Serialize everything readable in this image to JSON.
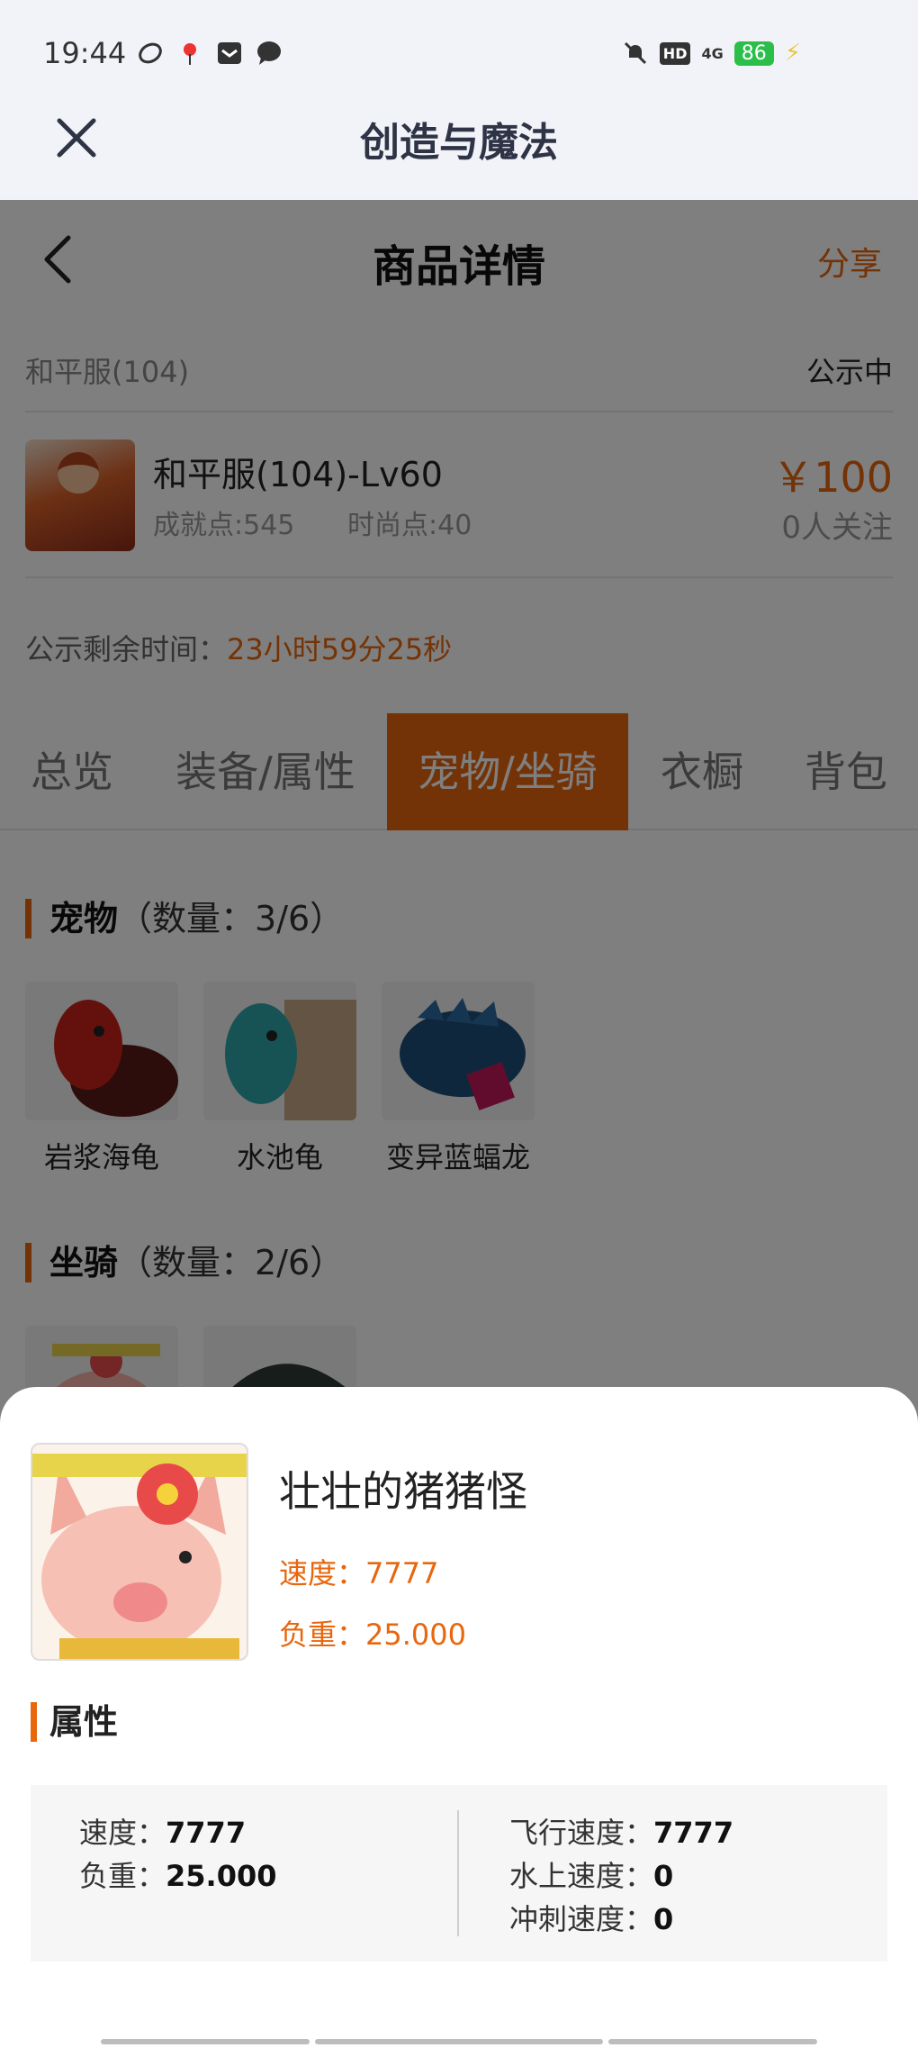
{
  "status_bar": {
    "time": "19:44",
    "network": "4G",
    "battery": "86"
  },
  "app_bar": {
    "title": "创造与魔法"
  },
  "nav": {
    "title": "商品详情",
    "share": "分享"
  },
  "server": {
    "name": "和平服(104)",
    "status": "公示中"
  },
  "product": {
    "name": "和平服(104)-Lv60",
    "achievement": "成就点:545",
    "fashion": "时尚点:40",
    "price": "￥100",
    "followers": "0人关注"
  },
  "remaining": {
    "label": "公示剩余时间：",
    "value": "23小时59分25秒"
  },
  "tabs": [
    {
      "label": "总览"
    },
    {
      "label": "装备/属性"
    },
    {
      "label": "宠物/坐骑",
      "active": true
    },
    {
      "label": "衣橱"
    },
    {
      "label": "背包"
    }
  ],
  "pets_section": {
    "title": "宠物",
    "count": "（数量：3/6）",
    "items": [
      {
        "name": "岩浆海龟",
        "icon": "red-turtle-icon"
      },
      {
        "name": "水池龟",
        "icon": "teal-turtle-icon"
      },
      {
        "name": "变异蓝蝠龙",
        "icon": "blue-dragon-icon"
      }
    ]
  },
  "mounts_section": {
    "title": "坐骑",
    "count": "（数量：2/6）"
  },
  "sheet": {
    "name": "壮壮的猪猪怪",
    "speed": "速度：7777",
    "load": "负重：25.000",
    "attr_title": "属性",
    "attrs_left": [
      {
        "label": "速度：",
        "value": "7777"
      },
      {
        "label": "负重：",
        "value": "25.000"
      }
    ],
    "attrs_right": [
      {
        "label": "飞行速度：",
        "value": "7777"
      },
      {
        "label": "水上速度：",
        "value": "0"
      },
      {
        "label": "冲刺速度：",
        "value": "0"
      }
    ]
  },
  "colors": {
    "accent": "#e8660c",
    "header_bg": "#f2f3f8"
  }
}
